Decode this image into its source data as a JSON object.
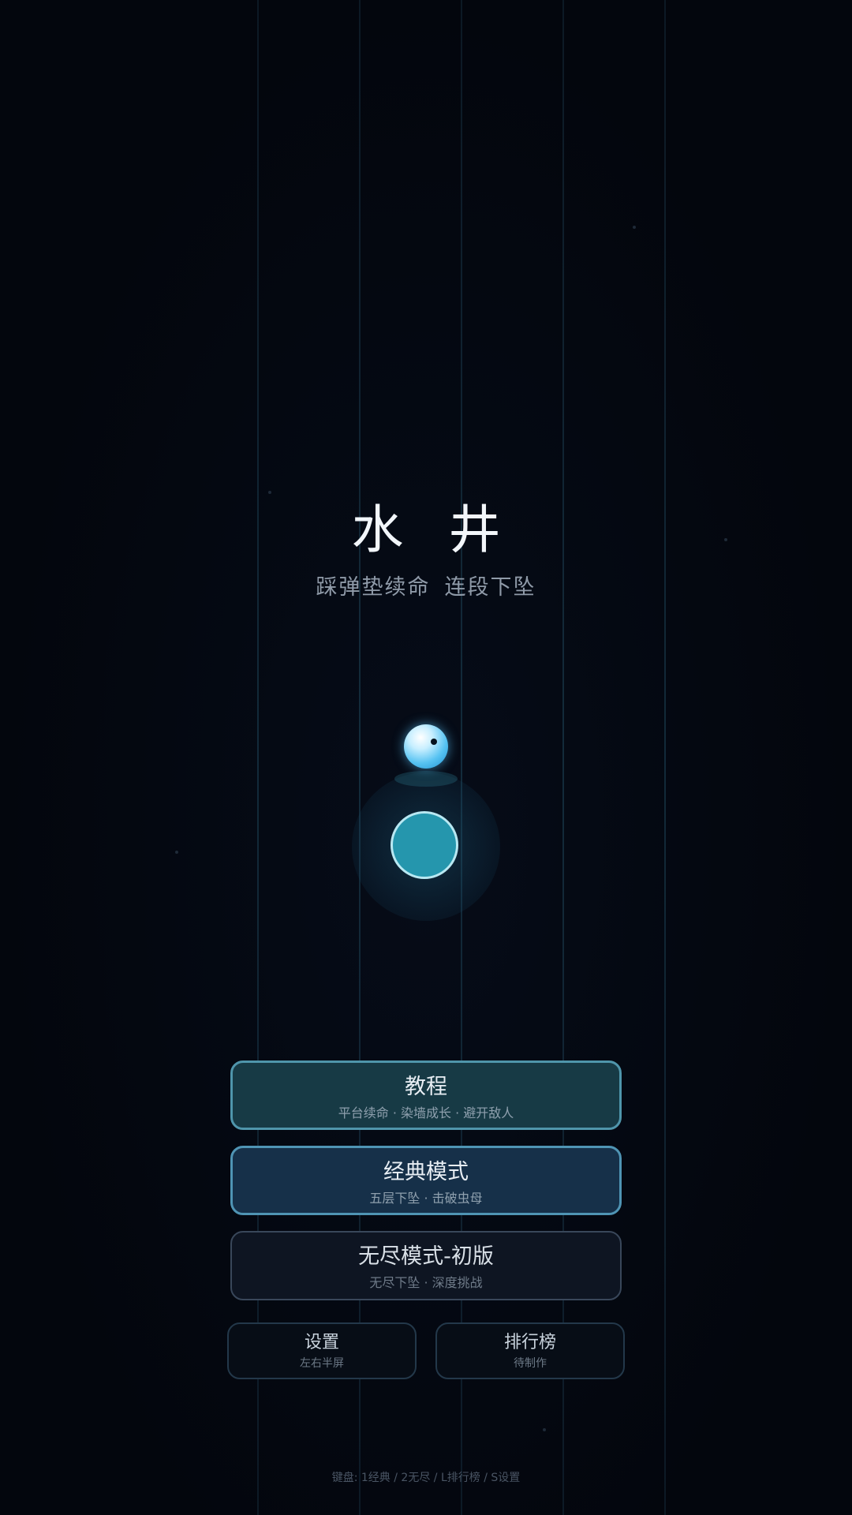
{
  "game": {
    "title": "水 井",
    "subtitle_part1": "踩弹垫续命",
    "subtitle_part2": "连段下坠"
  },
  "menu": {
    "tutorial": {
      "label": "教程",
      "desc": "平台续命 · 染墙成长 · 避开敌人"
    },
    "classic": {
      "label": "经典模式",
      "desc": "五层下坠 · 击破虫母"
    },
    "endless": {
      "label": "无尽模式-初版",
      "desc": "无尽下坠 · 深度挑战"
    },
    "settings": {
      "label": "设置",
      "desc": "左右半屏"
    },
    "ranking": {
      "label": "排行榜",
      "desc": "待制作"
    }
  },
  "hint": "键盘: 1经典 / 2无尽 / L排行榜 / S设置",
  "colors": {
    "background": "#04070f",
    "pad": "#2596ad",
    "ball": "#57c3f2",
    "tutorial_fill": "#173a45",
    "classic_fill": "#163049",
    "endless_fill": "#0e1522"
  },
  "icons": {
    "player": "water-droplet-character",
    "platform": "bounce-pad"
  }
}
